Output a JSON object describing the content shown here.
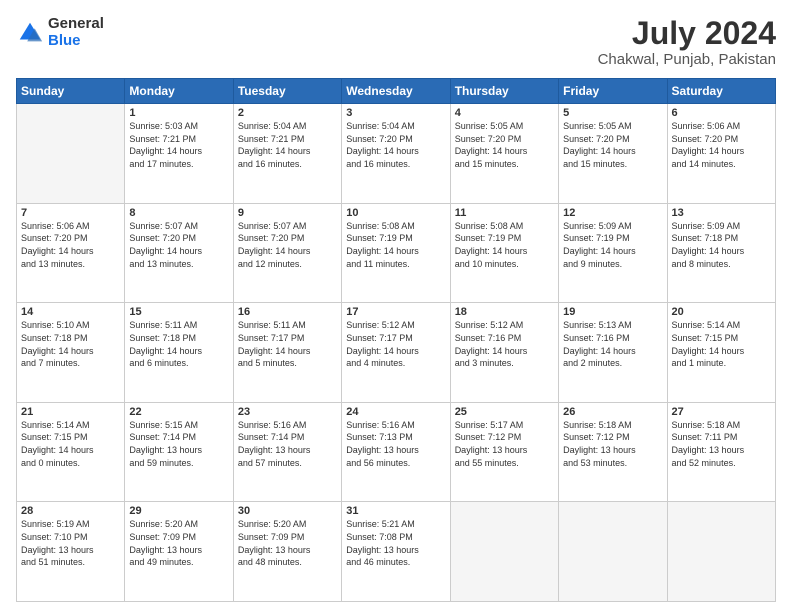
{
  "header": {
    "logo_general": "General",
    "logo_blue": "Blue",
    "title": "July 2024",
    "subtitle": "Chakwal, Punjab, Pakistan"
  },
  "calendar": {
    "headers": [
      "Sunday",
      "Monday",
      "Tuesday",
      "Wednesday",
      "Thursday",
      "Friday",
      "Saturday"
    ],
    "rows": [
      [
        {
          "day": "",
          "info": ""
        },
        {
          "day": "1",
          "info": "Sunrise: 5:03 AM\nSunset: 7:21 PM\nDaylight: 14 hours\nand 17 minutes."
        },
        {
          "day": "2",
          "info": "Sunrise: 5:04 AM\nSunset: 7:21 PM\nDaylight: 14 hours\nand 16 minutes."
        },
        {
          "day": "3",
          "info": "Sunrise: 5:04 AM\nSunset: 7:20 PM\nDaylight: 14 hours\nand 16 minutes."
        },
        {
          "day": "4",
          "info": "Sunrise: 5:05 AM\nSunset: 7:20 PM\nDaylight: 14 hours\nand 15 minutes."
        },
        {
          "day": "5",
          "info": "Sunrise: 5:05 AM\nSunset: 7:20 PM\nDaylight: 14 hours\nand 15 minutes."
        },
        {
          "day": "6",
          "info": "Sunrise: 5:06 AM\nSunset: 7:20 PM\nDaylight: 14 hours\nand 14 minutes."
        }
      ],
      [
        {
          "day": "7",
          "info": "Sunrise: 5:06 AM\nSunset: 7:20 PM\nDaylight: 14 hours\nand 13 minutes."
        },
        {
          "day": "8",
          "info": "Sunrise: 5:07 AM\nSunset: 7:20 PM\nDaylight: 14 hours\nand 13 minutes."
        },
        {
          "day": "9",
          "info": "Sunrise: 5:07 AM\nSunset: 7:20 PM\nDaylight: 14 hours\nand 12 minutes."
        },
        {
          "day": "10",
          "info": "Sunrise: 5:08 AM\nSunset: 7:19 PM\nDaylight: 14 hours\nand 11 minutes."
        },
        {
          "day": "11",
          "info": "Sunrise: 5:08 AM\nSunset: 7:19 PM\nDaylight: 14 hours\nand 10 minutes."
        },
        {
          "day": "12",
          "info": "Sunrise: 5:09 AM\nSunset: 7:19 PM\nDaylight: 14 hours\nand 9 minutes."
        },
        {
          "day": "13",
          "info": "Sunrise: 5:09 AM\nSunset: 7:18 PM\nDaylight: 14 hours\nand 8 minutes."
        }
      ],
      [
        {
          "day": "14",
          "info": "Sunrise: 5:10 AM\nSunset: 7:18 PM\nDaylight: 14 hours\nand 7 minutes."
        },
        {
          "day": "15",
          "info": "Sunrise: 5:11 AM\nSunset: 7:18 PM\nDaylight: 14 hours\nand 6 minutes."
        },
        {
          "day": "16",
          "info": "Sunrise: 5:11 AM\nSunset: 7:17 PM\nDaylight: 14 hours\nand 5 minutes."
        },
        {
          "day": "17",
          "info": "Sunrise: 5:12 AM\nSunset: 7:17 PM\nDaylight: 14 hours\nand 4 minutes."
        },
        {
          "day": "18",
          "info": "Sunrise: 5:12 AM\nSunset: 7:16 PM\nDaylight: 14 hours\nand 3 minutes."
        },
        {
          "day": "19",
          "info": "Sunrise: 5:13 AM\nSunset: 7:16 PM\nDaylight: 14 hours\nand 2 minutes."
        },
        {
          "day": "20",
          "info": "Sunrise: 5:14 AM\nSunset: 7:15 PM\nDaylight: 14 hours\nand 1 minute."
        }
      ],
      [
        {
          "day": "21",
          "info": "Sunrise: 5:14 AM\nSunset: 7:15 PM\nDaylight: 14 hours\nand 0 minutes."
        },
        {
          "day": "22",
          "info": "Sunrise: 5:15 AM\nSunset: 7:14 PM\nDaylight: 13 hours\nand 59 minutes."
        },
        {
          "day": "23",
          "info": "Sunrise: 5:16 AM\nSunset: 7:14 PM\nDaylight: 13 hours\nand 57 minutes."
        },
        {
          "day": "24",
          "info": "Sunrise: 5:16 AM\nSunset: 7:13 PM\nDaylight: 13 hours\nand 56 minutes."
        },
        {
          "day": "25",
          "info": "Sunrise: 5:17 AM\nSunset: 7:12 PM\nDaylight: 13 hours\nand 55 minutes."
        },
        {
          "day": "26",
          "info": "Sunrise: 5:18 AM\nSunset: 7:12 PM\nDaylight: 13 hours\nand 53 minutes."
        },
        {
          "day": "27",
          "info": "Sunrise: 5:18 AM\nSunset: 7:11 PM\nDaylight: 13 hours\nand 52 minutes."
        }
      ],
      [
        {
          "day": "28",
          "info": "Sunrise: 5:19 AM\nSunset: 7:10 PM\nDaylight: 13 hours\nand 51 minutes."
        },
        {
          "day": "29",
          "info": "Sunrise: 5:20 AM\nSunset: 7:09 PM\nDaylight: 13 hours\nand 49 minutes."
        },
        {
          "day": "30",
          "info": "Sunrise: 5:20 AM\nSunset: 7:09 PM\nDaylight: 13 hours\nand 48 minutes."
        },
        {
          "day": "31",
          "info": "Sunrise: 5:21 AM\nSunset: 7:08 PM\nDaylight: 13 hours\nand 46 minutes."
        },
        {
          "day": "",
          "info": ""
        },
        {
          "day": "",
          "info": ""
        },
        {
          "day": "",
          "info": ""
        }
      ]
    ]
  }
}
